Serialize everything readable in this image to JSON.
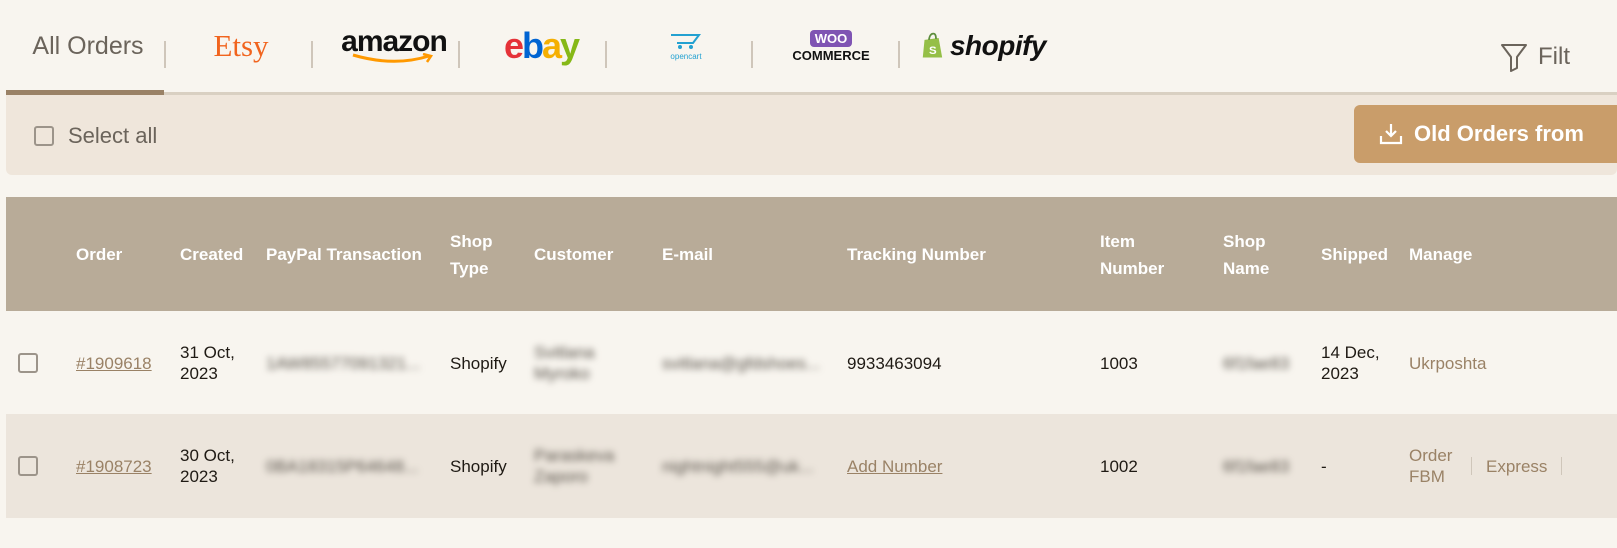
{
  "tabs": {
    "all_orders": "All Orders",
    "etsy": "Etsy",
    "amazon": "amazon",
    "ebay": [
      "e",
      "b",
      "a",
      "y"
    ],
    "opencart": "opencart",
    "woo_top": "WOO",
    "woo_bottom": "COMMERCE",
    "shopify": "shopify",
    "filter": "Filt"
  },
  "toolbar": {
    "select_all": "Select all",
    "old_orders_button": "Old Orders from"
  },
  "table": {
    "headers": {
      "order": "Order",
      "created": "Created",
      "paypal": "PayPal Transaction",
      "shop_type_1": "Shop",
      "shop_type_2": "Type",
      "customer": "Customer",
      "email": "E-mail",
      "tracking": "Tracking Number",
      "item_1": "Item",
      "item_2": "Number",
      "shop_name_1": "Shop",
      "shop_name_2": "Name",
      "shipped": "Shipped",
      "manage": "Manage"
    },
    "rows": [
      {
        "order": "#1909618",
        "created_1": "31 Oct,",
        "created_2": "2023",
        "paypal": "1AW85577091321...",
        "shop_type": "Shopify",
        "customer_1": "Svitlana",
        "customer_2": "Myroko",
        "email": "svitlana@gfdshoes...",
        "tracking": "9933463094",
        "item": "1003",
        "shop_name": "6f1fae83",
        "shipped_1": "14 Dec,",
        "shipped_2": "2023",
        "manage": [
          "Ukrposhta"
        ]
      },
      {
        "order": "#1908723",
        "created_1": "30 Oct,",
        "created_2": "2023",
        "paypal": "0BA18315P64648...",
        "shop_type": "Shopify",
        "customer_1": "Paraskeva",
        "customer_2": "Zaporo",
        "email": "nightnight555@uk...",
        "tracking": "Add Number",
        "item": "1002",
        "shop_name": "6f1fae83",
        "shipped_1": "-",
        "shipped_2": "",
        "manage": [
          "Order FBM",
          "Express"
        ]
      }
    ]
  },
  "colors": {
    "accent": "#9a8266",
    "header_bg": "#b8ab98",
    "button_bg": "#c99d6a",
    "toolbar_bg": "#efe6db"
  }
}
